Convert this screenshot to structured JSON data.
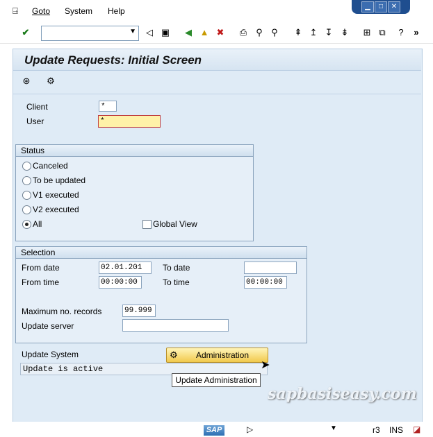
{
  "menu": {
    "items": [
      "Goto",
      "System",
      "Help"
    ]
  },
  "title": "Update Requests: Initial Screen",
  "fields": {
    "client_label": "Client",
    "client_value": "*",
    "user_label": "User",
    "user_value": "*"
  },
  "status_group": {
    "title": "Status",
    "options": [
      "Canceled",
      "To be updated",
      "V1 executed",
      "V2 executed",
      "All"
    ],
    "selected": "All",
    "global_view_label": "Global View"
  },
  "selection_group": {
    "title": "Selection",
    "from_date_label": "From date",
    "from_date_value": "02.01.201",
    "to_date_label": "To date",
    "to_date_value": "",
    "from_time_label": "From time",
    "from_time_value": "00:00:00",
    "to_time_label": "To time",
    "to_time_value": "00:00:00",
    "max_records_label": "Maximum no. records",
    "max_records_value": "99.999",
    "update_server_label": "Update server",
    "update_server_value": ""
  },
  "update_system": {
    "label": "Update System",
    "admin_button": "Administration",
    "status_text": "Update is active",
    "tooltip": "Update Administration"
  },
  "watermark": "sapbasiseasy.com",
  "statusbar": {
    "logo": "SAP",
    "session": "r3",
    "mode": "INS"
  },
  "colors": {
    "panel": "#dfebf6",
    "required_field": "#fff2a8",
    "button": "#f1c94c"
  }
}
